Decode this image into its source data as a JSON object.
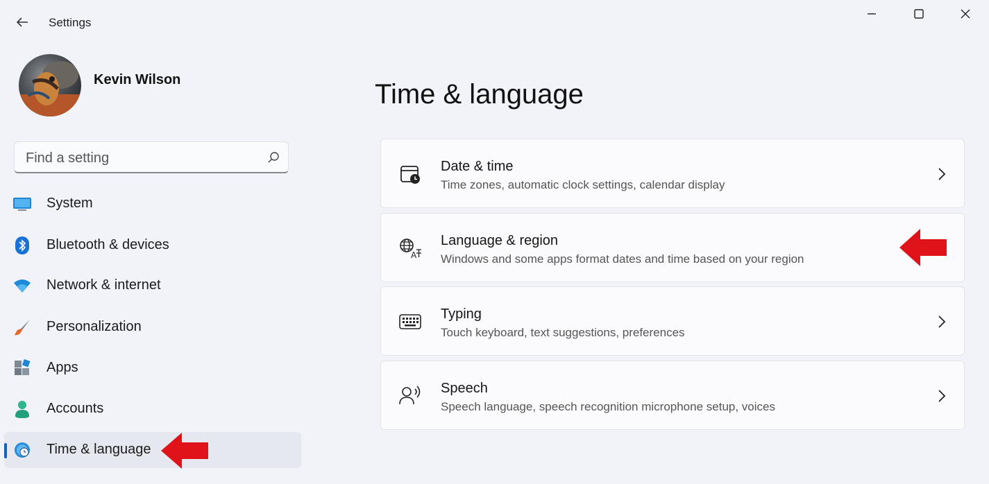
{
  "window": {
    "title": "Settings",
    "icons": {
      "back": "back-arrow-icon",
      "minimize": "minimize-icon",
      "maximize": "maximize-icon",
      "close": "close-icon"
    }
  },
  "user": {
    "name": "Kevin Wilson"
  },
  "search": {
    "placeholder": "Find a setting",
    "value": "",
    "icon": "search-icon"
  },
  "sidebar": {
    "items": [
      {
        "label": "System",
        "icon": "system-icon",
        "selected": false
      },
      {
        "label": "Bluetooth & devices",
        "icon": "bluetooth-icon",
        "selected": false
      },
      {
        "label": "Network & internet",
        "icon": "wifi-icon",
        "selected": false
      },
      {
        "label": "Personalization",
        "icon": "brush-icon",
        "selected": false
      },
      {
        "label": "Apps",
        "icon": "apps-icon",
        "selected": false
      },
      {
        "label": "Accounts",
        "icon": "accounts-icon",
        "selected": false
      },
      {
        "label": "Time & language",
        "icon": "time-language-icon",
        "selected": true
      }
    ]
  },
  "main": {
    "title": "Time & language",
    "cards": [
      {
        "title": "Date & time",
        "subtitle": "Time zones, automatic clock settings, calendar display",
        "icon": "calendar-clock-icon"
      },
      {
        "title": "Language & region",
        "subtitle": "Windows and some apps format dates and time based on your region",
        "icon": "language-icon"
      },
      {
        "title": "Typing",
        "subtitle": "Touch keyboard, text suggestions, preferences",
        "icon": "keyboard-icon"
      },
      {
        "title": "Speech",
        "subtitle": "Speech language, speech recognition microphone setup, voices",
        "icon": "speech-icon"
      }
    ]
  },
  "annotations": {
    "arrow_color": "#e0131a"
  },
  "colors": {
    "accent": "#1560c4",
    "background": "#f1f3f9",
    "card": "#fbfbfd"
  }
}
